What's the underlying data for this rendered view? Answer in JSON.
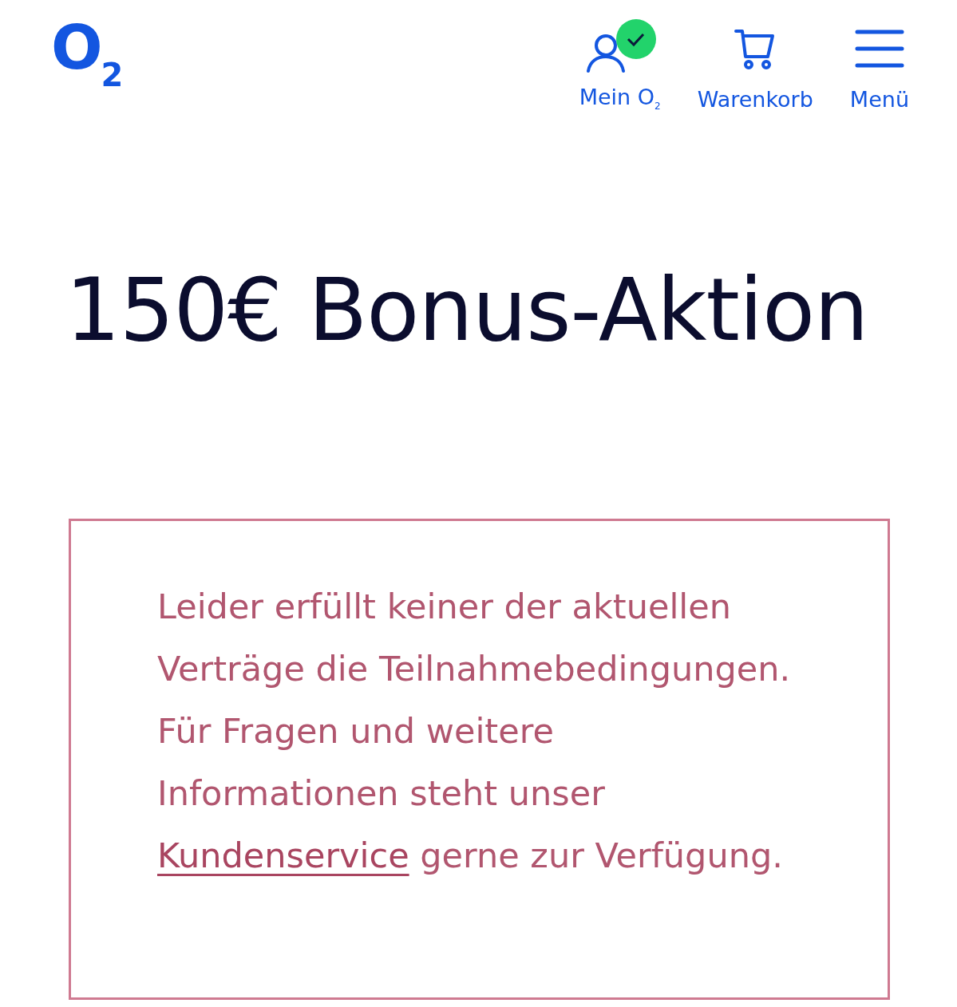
{
  "header": {
    "logo": "O$_{2}$",
    "nav": [
      {
        "kind": "account",
        "label": "Mein O$_{2}$",
        "logged_in": true
      },
      {
        "kind": "cart",
        "label": "Warenkorb"
      },
      {
        "kind": "menu",
        "label": "Menü"
      }
    ]
  },
  "title": "150€ Bonus-Aktion",
  "notice": {
    "text_before": "Leider erfüllt keiner der aktuellen Verträge die Teilnahmebedingungen. Für Fragen und weitere Informationen steht unser",
    "link": "Kundenservice",
    "text_after": "gerne zur Verfügung."
  }
}
